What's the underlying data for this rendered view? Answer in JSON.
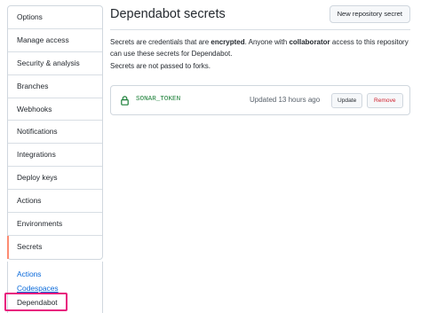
{
  "sidebar": {
    "items": [
      {
        "label": "Options"
      },
      {
        "label": "Manage access"
      },
      {
        "label": "Security & analysis"
      },
      {
        "label": "Branches"
      },
      {
        "label": "Webhooks"
      },
      {
        "label": "Notifications"
      },
      {
        "label": "Integrations"
      },
      {
        "label": "Deploy keys"
      },
      {
        "label": "Actions"
      },
      {
        "label": "Environments"
      },
      {
        "label": "Secrets"
      }
    ],
    "selected": "Secrets",
    "subitems": [
      {
        "label": "Actions"
      },
      {
        "label": "Codespaces"
      },
      {
        "label": "Dependabot"
      }
    ],
    "active_subitem": "Dependabot"
  },
  "header": {
    "title": "Dependabot secrets",
    "new_button_label": "New repository secret"
  },
  "description": {
    "part1": "Secrets are credentials that are ",
    "bold1": "encrypted",
    "part2": ". Anyone with ",
    "bold2": "collaborator",
    "part3": " access to this repository can use these secrets for Dependabot.",
    "forks_note": "Secrets are not passed to forks."
  },
  "secrets": [
    {
      "name": "SONAR_TOKEN",
      "updated": "Updated 13 hours ago",
      "update_label": "Update",
      "remove_label": "Remove",
      "icon": "lock-icon"
    }
  ],
  "colors": {
    "accent_selected": "#fd8c73",
    "link": "#0969da",
    "secret_name": "#1a7f37",
    "danger": "#cf222e",
    "annotation_highlight": "#e8197d"
  }
}
